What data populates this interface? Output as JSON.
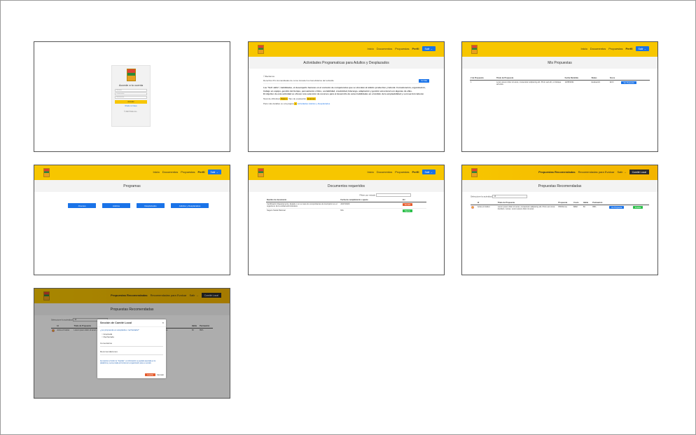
{
  "nav": {
    "inicio": "Inicio",
    "documentos": "Documentos",
    "propuestas": "Propuestas",
    "perfil": "Perfil",
    "salir": "Salir →",
    "recomendadas": "Propuestas Recomendadas",
    "recomendadas_evaluar": "Recomendadas para Evaluar",
    "salir_text": "Salir →",
    "comite": "Comité Local"
  },
  "login": {
    "title": "Accede a tu cuenta",
    "user_placeholder": "Usuario",
    "pass_placeholder": "Contraseña",
    "verify_placeholder": "Verificación",
    "button": "Acceder",
    "forgot": "Olvidé mi Clave",
    "copyright": "© 2023 Todos los..."
  },
  "p2": {
    "title": "Actividades Programaticas para Adultos y Desplazados",
    "checkbox_label": "Reclamos",
    "line1": "Derechos Pro Humanidades de como Acceder los beneficiarios del subsidio",
    "line1_btn": "Ver Mas",
    "paragraph": "Las \"Soft skills\", habilidades, el desempeño humano en el contexto de competencias que se vinculan al ámbito productivo y laboral. Comunicación, organización, trabajo en equipo, gestión del tiempo, pensamiento crítico, sociabilidad, creatividad, liderazgo, adaptación y gestión emocional son algunas de ellas.",
    "paragraph2": "El objetivo de esta actividad es ofrecer una selección de recursos para el desarrollo de estas habilidades en el ámbito de la empleabilidad y su inserción laboral.",
    "meta_label1": "Nivel de dificultad",
    "meta_val1": "Básico",
    "meta_label2": "Tipo de evaluación",
    "meta_val2": "Examen",
    "footer_label": "Para más detalles ve a la página",
    "footer_num": "4",
    "footer_link": "Actividades Adultos y Desplazados"
  },
  "p3": {
    "title": "Mis Propuestas",
    "columns": [
      "# de Propuesta",
      "Título de Propuesta",
      "Fecha Remitida",
      "Status",
      "Score",
      ""
    ],
    "row": [
      "1",
      "Lorem ipsum dolor sit amet, consectetur adipiscing elit. Proin sed elit, ut tristique ad tellus.",
      "12/08/2021",
      "Evaluación",
      "ECO",
      "Ver Propuesta"
    ]
  },
  "p4": {
    "title": "Programas",
    "buttons": [
      "Jóvenes",
      "Adultos",
      "Desplazados",
      "Adultos y Desplazados"
    ]
  },
  "p5": {
    "title": "Documentos requeridos",
    "filter_label": "Filtrar por estado",
    "columns": [
      "Nombre de documento",
      "Fecha de cumplimiento o ajuste",
      "Ver"
    ],
    "rows": [
      [
        "Certificación Departamento, Estado o en su caso los comprobantes de inscripción en el organismo de la unidad administrativa",
        "24/07/2020",
        "Vencido"
      ],
      [
        "Seguro Social Patronal",
        "N/A",
        "Vigente"
      ]
    ]
  },
  "p6": {
    "title": "Propuestas Recomendadas",
    "filter_label": "Seleccione la actividad",
    "filter_value": "13",
    "columns": [
      "",
      "Id",
      "Título de Propuesta",
      "Propuesta",
      "Costo",
      "Habla",
      "Puntuación",
      "",
      ""
    ],
    "row": [
      "",
      "Actos el Institut",
      "Lorem ipsum dolor sit amet, consectetur adipiscing elit. Proin est nisl at tincidunt, cursus. Lorem ipsum dolor sit amet.",
      "PROforma",
      "$962",
      "60",
      "89%",
      "Ver Propuesta",
      "Evaluar"
    ]
  },
  "p7": {
    "title": "Propuestas Recomendadas",
    "modal_title": "Sección de Comité Local",
    "modal_q1": "¿La propuesta es aceptada o rechazada?",
    "modal_opt1": "Aceptada",
    "modal_opt2": "Rechazada",
    "modal_f1": "Comentarios",
    "modal_f2": "Recomendaciones",
    "modal_note": "Al presionar el botón de \"Guardar\", su información se quedará asentada en la plataforma y será enviada al Comité de la organización para su revisión.",
    "save": "Guardar",
    "cancel": "Cancelar"
  }
}
